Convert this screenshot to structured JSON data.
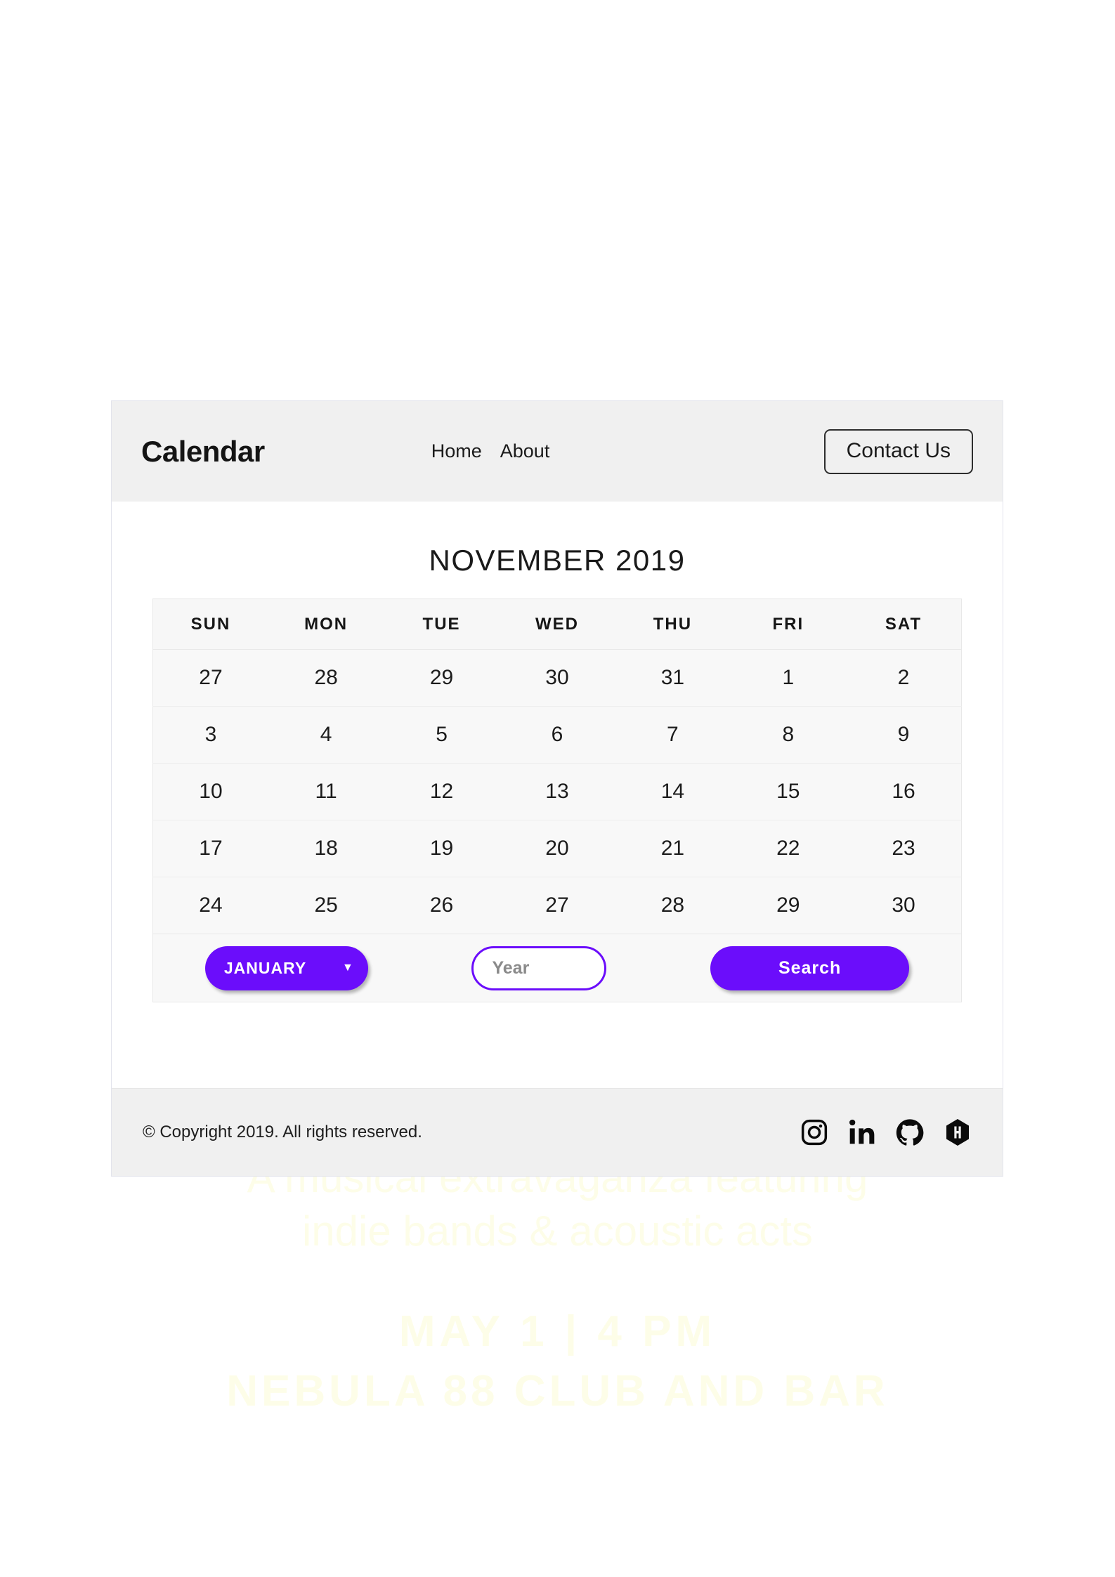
{
  "header": {
    "brand": "Calendar",
    "nav": [
      {
        "label": "Home",
        "name": "nav-link-home"
      },
      {
        "label": "About",
        "name": "nav-link-about"
      }
    ],
    "contact_label": "Contact Us"
  },
  "calendar": {
    "month_title": "NOVEMBER 2019",
    "weekdays": [
      "SUN",
      "MON",
      "TUE",
      "WED",
      "THU",
      "FRI",
      "SAT"
    ],
    "weeks": [
      [
        {
          "day": "27",
          "muted": true
        },
        {
          "day": "28",
          "muted": true
        },
        {
          "day": "29",
          "muted": true
        },
        {
          "day": "30",
          "muted": true
        },
        {
          "day": "31",
          "muted": true
        },
        {
          "day": "1",
          "muted": false
        },
        {
          "day": "2",
          "muted": false
        }
      ],
      [
        {
          "day": "3",
          "muted": false
        },
        {
          "day": "4",
          "muted": false
        },
        {
          "day": "5",
          "muted": false
        },
        {
          "day": "6",
          "muted": false,
          "selected": true
        },
        {
          "day": "7",
          "muted": false
        },
        {
          "day": "8",
          "muted": false
        },
        {
          "day": "9",
          "muted": false
        }
      ],
      [
        {
          "day": "10",
          "muted": false
        },
        {
          "day": "11",
          "muted": false
        },
        {
          "day": "12",
          "muted": false
        },
        {
          "day": "13",
          "muted": false
        },
        {
          "day": "14",
          "muted": false
        },
        {
          "day": "15",
          "muted": false
        },
        {
          "day": "16",
          "muted": false
        }
      ],
      [
        {
          "day": "17",
          "muted": false
        },
        {
          "day": "18",
          "muted": false
        },
        {
          "day": "19",
          "muted": false
        },
        {
          "day": "20",
          "muted": false
        },
        {
          "day": "21",
          "muted": false
        },
        {
          "day": "22",
          "muted": false
        },
        {
          "day": "23",
          "muted": false
        }
      ],
      [
        {
          "day": "24",
          "muted": false
        },
        {
          "day": "25",
          "muted": false
        },
        {
          "day": "26",
          "muted": false
        },
        {
          "day": "27",
          "muted": false
        },
        {
          "day": "28",
          "muted": false
        },
        {
          "day": "29",
          "muted": false
        },
        {
          "day": "30",
          "muted": false
        }
      ]
    ],
    "selected_day": "6",
    "highlight_color": "#829ae2"
  },
  "controls": {
    "month_selected": "JANUARY",
    "month_caret": "▼",
    "year_value": "",
    "year_placeholder": "Year",
    "search_label": "Search",
    "accent_color": "#6b0dfb"
  },
  "footer": {
    "copyright": "© Copyright 2019. All rights reserved.",
    "social": [
      {
        "name": "instagram-icon",
        "label": "Instagram"
      },
      {
        "name": "linkedin-icon",
        "label": "LinkedIn"
      },
      {
        "name": "github-icon",
        "label": "GitHub"
      },
      {
        "name": "hashnode-icon",
        "label": "Hashnode"
      }
    ]
  },
  "poster": {
    "sub_line1": "A musical extravaganza featuring",
    "sub_line2": "indie bands & acoustic acts",
    "when": "MAY 1 | 4 PM",
    "venue": "NEBULA 88 CLUB AND BAR",
    "text_color": "#fdfde8"
  }
}
